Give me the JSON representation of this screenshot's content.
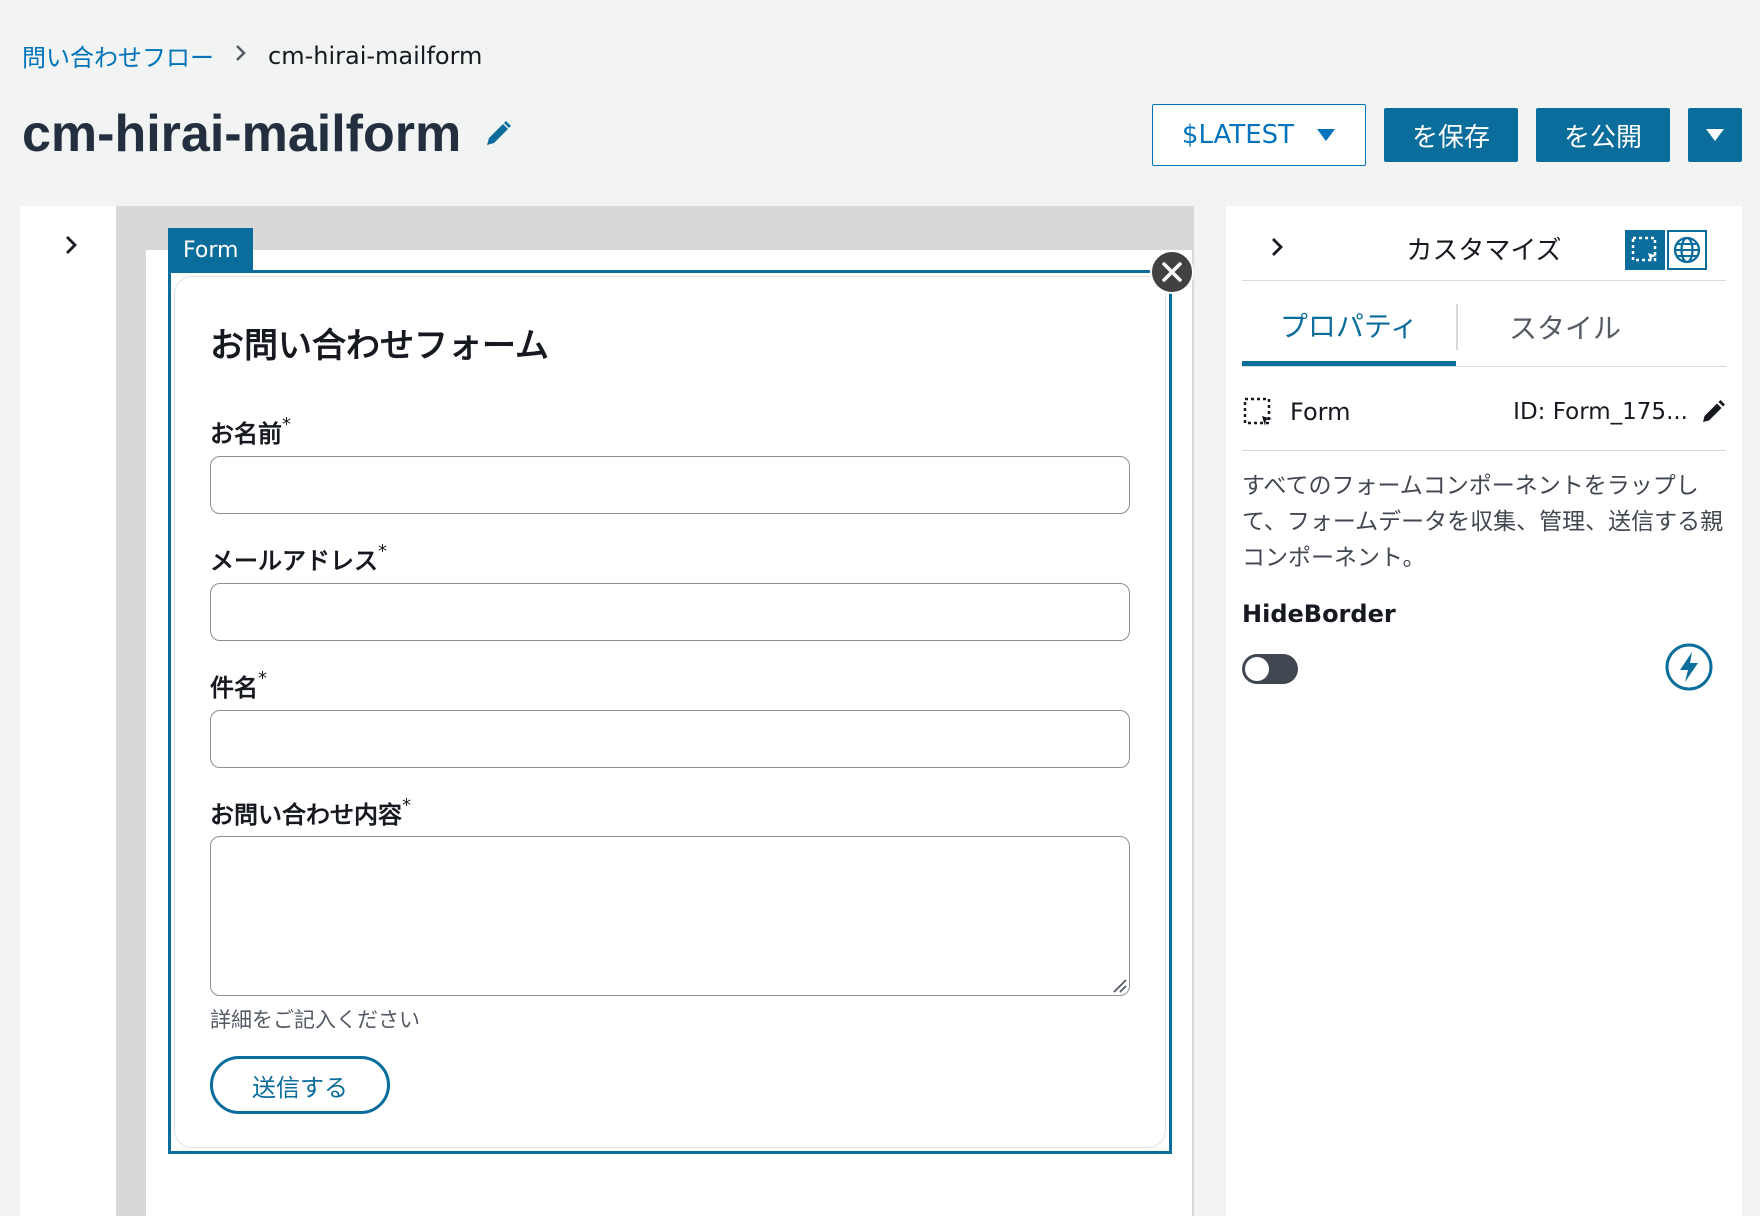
{
  "breadcrumb": {
    "parent": "問い合わせフロー",
    "current": "cm-hirai-mailform"
  },
  "page": {
    "title": "cm-hirai-mailform"
  },
  "header_actions": {
    "version": "$LATEST",
    "save": "を保存",
    "publish": "を公開"
  },
  "canvas": {
    "selected_tag": "Form",
    "form": {
      "heading": "お問い合わせフォーム",
      "fields": [
        {
          "label": "お名前",
          "required_mark": "*",
          "value": ""
        },
        {
          "label": "メールアドレス",
          "required_mark": "*",
          "value": ""
        },
        {
          "label": "件名",
          "required_mark": "*",
          "value": ""
        },
        {
          "label": "お問い合わせ内容",
          "required_mark": "*",
          "value": ""
        }
      ],
      "hint": "詳細をご記入ください",
      "submit_label": "送信する"
    }
  },
  "right_panel": {
    "title": "カスタマイズ",
    "tabs": [
      "プロパティ",
      "スタイル"
    ],
    "active_tab": "プロパティ",
    "component": {
      "name": "Form",
      "id": "ID: Form_175..."
    },
    "description": "すべてのフォームコンポーネントをラップして、フォームデータを収集、管理、送信する親コンポーネント。",
    "property": {
      "label": "HideBorder",
      "enabled": false
    }
  },
  "colors": {
    "accent": "#0a6d9c",
    "link": "#0073bb",
    "background": "#f2f3f3",
    "toggle_off": "#414750"
  },
  "icons": [
    "chevron-right-icon",
    "edit-pencil-icon",
    "caret-down-icon",
    "close-icon",
    "selection-icon",
    "globe-icon",
    "lightning-icon",
    "resize-grip-icon"
  ]
}
